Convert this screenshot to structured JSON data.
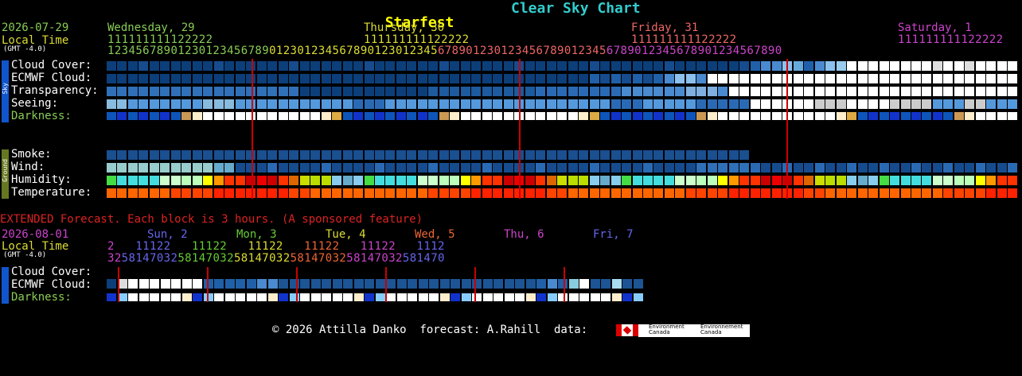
{
  "header": {
    "title": "Starfest",
    "subtitle": "Clear Sky Chart",
    "title_color": "#ffff00",
    "subtitle_color": "#33cccc"
  },
  "main": {
    "date": "2026-07-29",
    "local_time_label": "Local Time",
    "gmt_label": "(GMT -4.0)",
    "days": [
      {
        "label": "Wednesday, 29",
        "color": "#88cc55"
      },
      {
        "label": "Thursday, 30",
        "color": "#dddd33"
      },
      {
        "label": "Friday, 31",
        "color": "#ee6666"
      },
      {
        "label": "Saturday, 1",
        "color": "#cc44cc"
      }
    ],
    "hour_tens": "111111111122222",
    "hour_ones": "123456789012301234567890123012345678901230123456789012301234567890123456789012345678901234567890",
    "sky_tag": "Sky",
    "ground_tag": "Ground",
    "rows": [
      {
        "label": "Cloud Cover:"
      },
      {
        "label": "ECMWF Cloud:"
      },
      {
        "label": "Transparency:"
      },
      {
        "label": "Seeing:"
      },
      {
        "label": "Darkness:",
        "color": "#88cc55"
      },
      {
        "label": "Smoke:"
      },
      {
        "label": "Wind:"
      },
      {
        "label": "Humidity:"
      },
      {
        "label": "Temperature:"
      }
    ]
  },
  "extended": {
    "heading": "EXTENDED Forecast. Each block is 3 hours. (A sponsored feature)",
    "heading_color": "#dd2222",
    "date": "2026-08-01",
    "local_time_label": "Local Time",
    "gmt_label": "(GMT -4.0)",
    "days": [
      {
        "label": "Sun, 2",
        "color": "#6666ee"
      },
      {
        "label": "Mon, 3",
        "color": "#66cc33"
      },
      {
        "label": "Tue, 4",
        "color": "#dddd33"
      },
      {
        "label": "Wed, 5",
        "color": "#ee6633"
      },
      {
        "label": "Thu, 6",
        "color": "#cc44cc"
      },
      {
        "label": "Fri, 7",
        "color": "#6666ee"
      }
    ],
    "tens_row": "2   11122   11122   11122   11122   11122   1112",
    "ones_row": "325814703258147032581470325814703258147032581470",
    "rows": [
      {
        "label": "Cloud Cover:"
      },
      {
        "label": "ECMWF Cloud:"
      },
      {
        "label": "Darkness:",
        "color": "#88cc55"
      }
    ]
  },
  "footer": {
    "credit": "© 2026 Attilla Danko  forecast: A.Rahill  data:",
    "env1": "Environment\nCanada",
    "env2": "Environnement\nCanada"
  }
}
